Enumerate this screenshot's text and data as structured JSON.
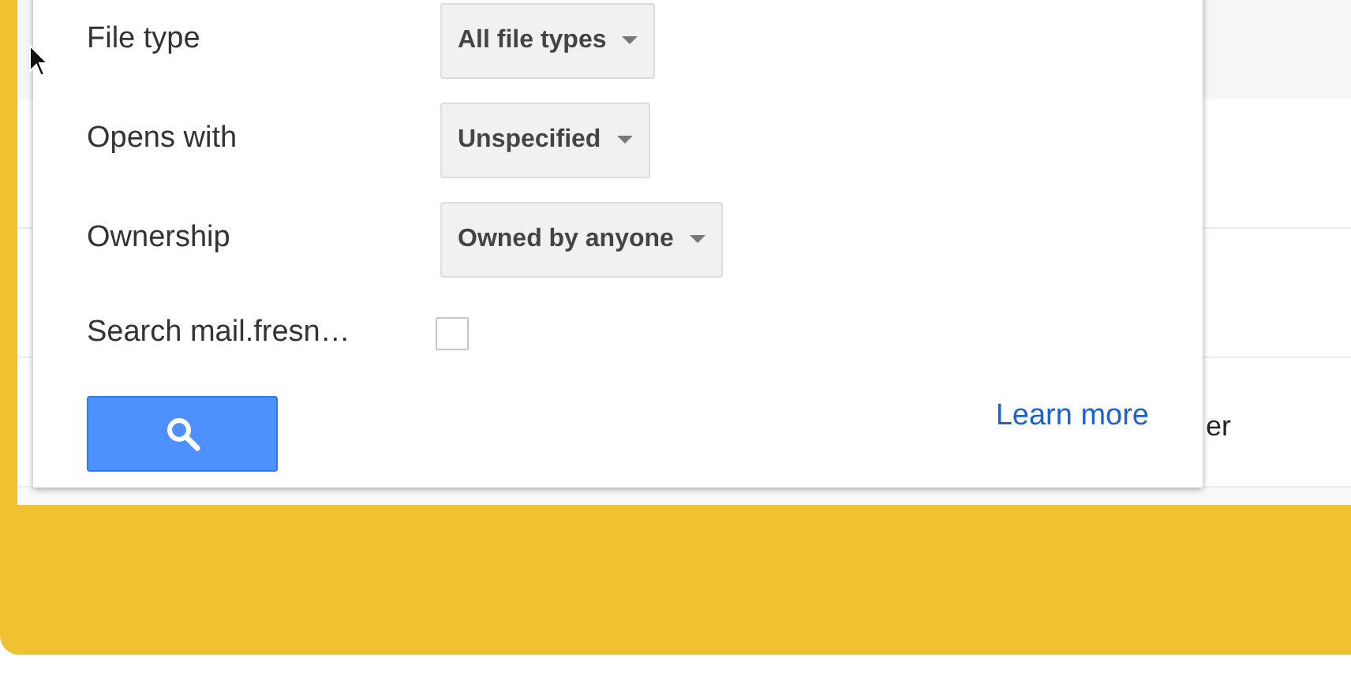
{
  "filters": [
    {
      "label": "File type",
      "value": "All file types"
    },
    {
      "label": "Opens with",
      "value": "Unspecified"
    },
    {
      "label": "Ownership",
      "value": "Owned by anyone"
    }
  ],
  "checkbox": {
    "label": "Search mail.fresn…",
    "checked": false
  },
  "link": "Learn more",
  "background_text": "er"
}
